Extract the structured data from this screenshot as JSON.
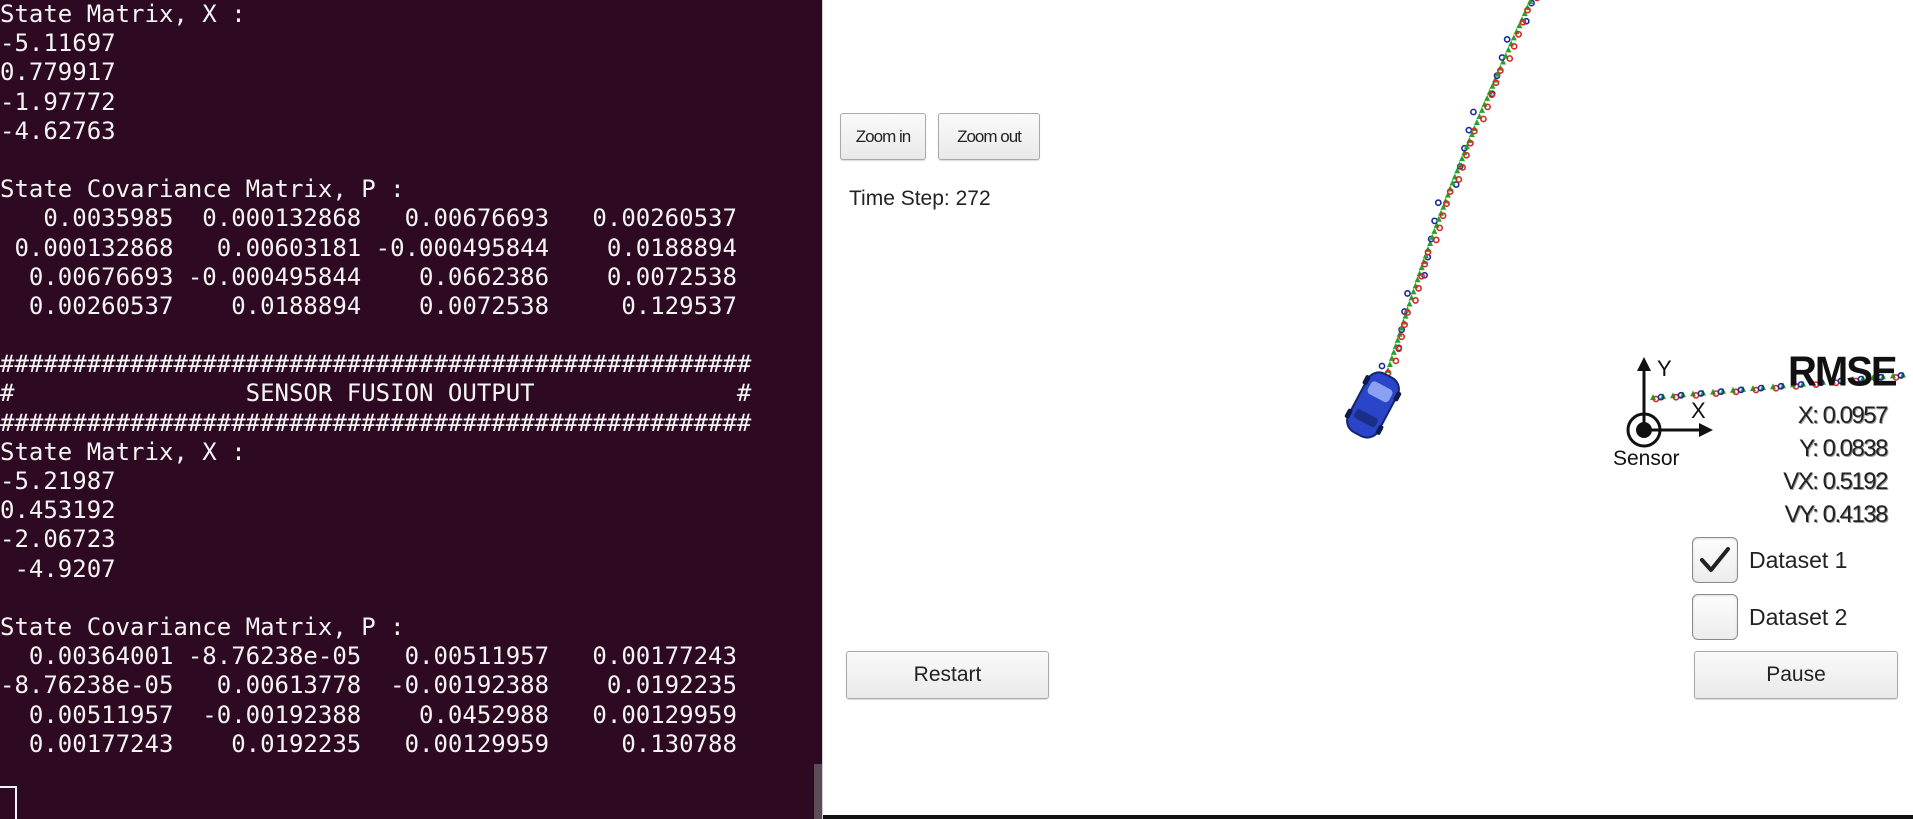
{
  "terminal": {
    "lines": [
      "State Matrix, X :",
      "-5.11697",
      "0.779917",
      "-1.97772",
      "-4.62763",
      "",
      "State Covariance Matrix, P :",
      "   0.0035985  0.000132868   0.00676693   0.00260537",
      " 0.000132868   0.00603181 -0.000495844    0.0188894",
      "  0.00676693 -0.000495844    0.0662386    0.0072538",
      "  0.00260537    0.0188894    0.0072538     0.129537",
      "",
      "####################################################",
      "#                SENSOR FUSION OUTPUT              #",
      "####################################################",
      "State Matrix, X :",
      "-5.21987",
      "0.453192",
      "-2.06723",
      " -4.9207",
      "",
      "State Covariance Matrix, P :",
      "  0.00364001 -8.76238e-05   0.00511957   0.00177243",
      "-8.76238e-05   0.00613778  -0.00192388    0.0192235",
      "  0.00511957  -0.00192388    0.0452988   0.00129959",
      "  0.00177243    0.0192235   0.00129959     0.130788"
    ]
  },
  "simulator": {
    "zoom_in_label": "Zoom in",
    "zoom_out_label": "Zoom out",
    "time_step_label": "Time Step:",
    "time_step_value": "272",
    "restart_label": "Restart",
    "pause_label": "Pause",
    "rmse": {
      "title": "RMSE",
      "x": "X: 0.0957",
      "y": "Y: 0.0838",
      "vx": "VX: 0.5192",
      "vy": "VY: 0.4138"
    },
    "datasets": [
      {
        "label": "Dataset 1",
        "checked": true
      },
      {
        "label": "Dataset 2",
        "checked": false
      }
    ],
    "sensor_label": "Sensor",
    "axis_x_label": "X",
    "axis_y_label": "Y",
    "colors": {
      "terminal_bg": "#2d0a22",
      "lidar": "#d62828",
      "radar": "#1b2a9c",
      "estimate": "#25a325",
      "car": "#2a45c8"
    }
  }
}
